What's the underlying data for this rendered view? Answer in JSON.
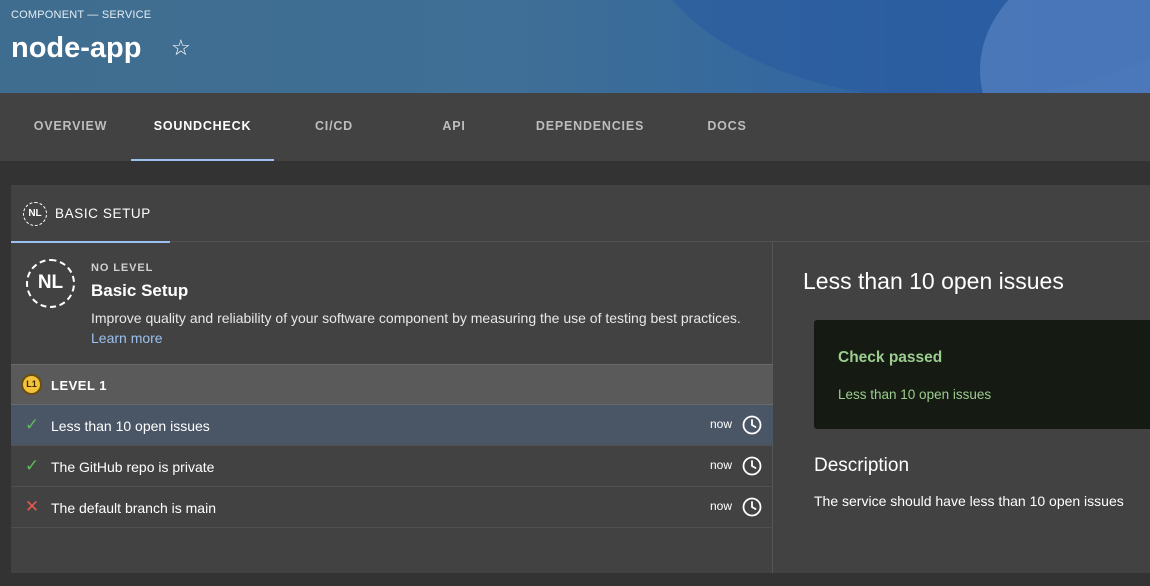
{
  "header": {
    "breadcrumb": "COMPONENT — SERVICE",
    "title": "node-app",
    "favorite_icon": "star-outline-icon"
  },
  "tabs": [
    {
      "label": "OVERVIEW",
      "active": false
    },
    {
      "label": "SOUNDCHECK",
      "active": true
    },
    {
      "label": "CI/CD",
      "active": false
    },
    {
      "label": "API",
      "active": false
    },
    {
      "label": "DEPENDENCIES",
      "active": false
    },
    {
      "label": "DOCS",
      "active": false
    }
  ],
  "track": {
    "tab_badge": "NL",
    "tab_label": "BASIC SETUP",
    "badge": "NL",
    "level_kicker": "NO LEVEL",
    "title": "Basic Setup",
    "description": "Improve quality and reliability of your software component by measuring the use of testing best practices.",
    "learn_more": "Learn more"
  },
  "level": {
    "badge": "L1",
    "label": "LEVEL 1"
  },
  "checks": [
    {
      "label": "Less than 10 open issues",
      "status": "passed",
      "icon": "check-icon",
      "time": "now",
      "selected": true
    },
    {
      "label": "The GitHub repo is private",
      "status": "passed",
      "icon": "check-icon",
      "time": "now",
      "selected": false
    },
    {
      "label": "The default branch is main",
      "status": "failed",
      "icon": "cross-icon",
      "time": "now",
      "selected": false
    }
  ],
  "detail": {
    "title": "Less than 10 open issues",
    "result_title": "Check passed",
    "result_text": "Less than 10 open issues",
    "description_heading": "Description",
    "description": "The service should have less than 10 open issues"
  },
  "colors": {
    "accent": "#9cc0ef",
    "pass": "#5ebd5e",
    "fail": "#e2594f",
    "result_text": "#9ccc8f"
  }
}
